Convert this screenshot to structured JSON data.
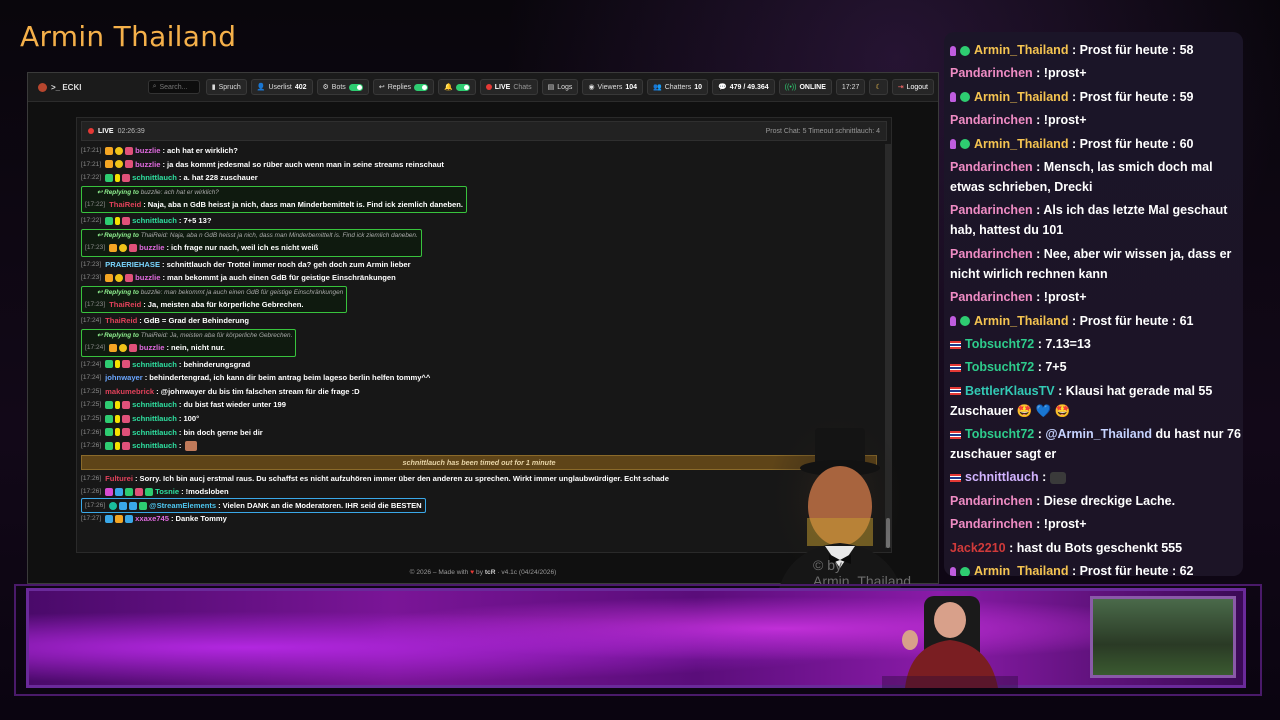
{
  "overlay": {
    "title": "Armin Thailand",
    "watermark": "© by Armin_Thailand"
  },
  "app": {
    "brand": ">_ ECKI",
    "search_placeholder": "Search...",
    "toolbar": {
      "spruch": "Spruch",
      "userlist": "Userlist",
      "userlist_count": "402",
      "bots": "Bots",
      "replies": "Replies",
      "live": "LIVE",
      "chats": "Chats",
      "logs": "Logs",
      "viewers": "Viewers",
      "viewers_count": "104",
      "chatters": "Chatters",
      "chatters_count": "10",
      "messages": "479 / 49.364",
      "status": "ONLINE",
      "time": "17:27",
      "logout": "Logout"
    },
    "chat_header": {
      "live": "LIVE",
      "uptime": "02:26:39",
      "right": "Prost Chat: 5   Timeout schnittlauch: 4"
    },
    "footer": {
      "left": "© 2026 – Made with",
      "by": "by",
      "author": "tcR",
      "version": "· v4.1c (04/24/2026)"
    }
  },
  "messages": [
    {
      "ts": "[17:21]",
      "badges": [
        "crown",
        "mod",
        "sub"
      ],
      "user": "buzzlie",
      "color": "#e06adf",
      "text": "ach hat er wirklich?"
    },
    {
      "ts": "[17:21]",
      "badges": [
        "crown",
        "mod",
        "sub"
      ],
      "user": "buzzlie",
      "color": "#e06adf",
      "text": "ja das kommt jedesmal so rüber auch wenn man in seine streams reinschaut"
    },
    {
      "ts": "[17:22]",
      "badges": [
        "vip",
        "bits",
        "sub"
      ],
      "user": "schnittlauch",
      "color": "#2ee0a0",
      "text": "a. hat 228 zuschauer"
    },
    {
      "reply": "buzzlie: ach hat er wirklich?",
      "ts": "[17:22]",
      "badges": [],
      "user": "ThaiReid",
      "color": "#e0415a",
      "text": "Naja, aba n GdB heisst ja nich, dass man Minderbemittelt is. Find ick ziemlich daneben."
    },
    {
      "ts": "[17:22]",
      "badges": [
        "vip",
        "bits",
        "sub"
      ],
      "user": "schnittlauch",
      "color": "#2ee0a0",
      "text": "7+5 13?"
    },
    {
      "reply": "ThaiReid: Naja, aba n GdB heisst ja nich, dass man Minderbemittelt is. Find ick ziemlich daneben.",
      "ts": "[17:23]",
      "badges": [
        "crown",
        "mod",
        "sub"
      ],
      "user": "buzzlie",
      "color": "#e06adf",
      "text": "ich frage nur nach, weil ich es nicht weiß"
    },
    {
      "ts": "[17:23]",
      "badges": [],
      "user": "PRAERIEHASE",
      "color": "#7ad7ff",
      "text": "schnittlauch der Trottel immer noch da? geh doch zum Armin lieber"
    },
    {
      "ts": "[17:23]",
      "badges": [
        "crown",
        "mod",
        "sub"
      ],
      "user": "buzzlie",
      "color": "#e06adf",
      "text": "man bekommt ja auch einen GdB für geistige Einschränkungen"
    },
    {
      "reply": "buzzlie: man bekommt ja auch einen GdB für geistige Einschränkungen",
      "ts": "[17:23]",
      "badges": [],
      "user": "ThaiReid",
      "color": "#e0415a",
      "text": "Ja, meisten aba für körperliche Gebrechen."
    },
    {
      "ts": "[17:24]",
      "badges": [],
      "user": "ThaiReid",
      "color": "#e0415a",
      "text": "GdB = Grad der Behinderung"
    },
    {
      "reply": "ThaiReid: Ja, meisten aba für körperliche Gebrechen.",
      "ts": "[17:24]",
      "badges": [
        "crown",
        "mod",
        "sub"
      ],
      "user": "buzzlie",
      "color": "#e06adf",
      "text": "nein, nicht nur."
    },
    {
      "ts": "[17:24]",
      "badges": [
        "vip",
        "bits",
        "sub"
      ],
      "user": "schnittlauch",
      "color": "#2ee0a0",
      "text": "behinderungsgrad"
    },
    {
      "ts": "[17:24]",
      "badges": [],
      "user": "johnwayer",
      "color": "#6aa6ff",
      "text": "behindertengrad, ich kann dir beim antrag beim lageso berlin helfen tommy^^"
    },
    {
      "ts": "[17:25]",
      "badges": [],
      "user": "makumebrick",
      "color": "#e0415a",
      "text": "@johnwayer du bis tim falschen stream für die frage :D"
    },
    {
      "ts": "[17:25]",
      "badges": [
        "vip",
        "bits",
        "sub"
      ],
      "user": "schnittlauch",
      "color": "#2ee0a0",
      "text": "du bist fast wieder unter 199"
    },
    {
      "ts": "[17:25]",
      "badges": [
        "vip",
        "bits",
        "sub"
      ],
      "user": "schnittlauch",
      "color": "#2ee0a0",
      "text": "100°"
    },
    {
      "ts": "[17:26]",
      "badges": [
        "vip",
        "bits",
        "sub"
      ],
      "user": "schnittlauch",
      "color": "#2ee0a0",
      "text": "bin doch gerne bei dir"
    },
    {
      "ts": "[17:26]",
      "badges": [
        "vip",
        "bits",
        "sub"
      ],
      "user": "schnittlauch",
      "color": "#2ee0a0",
      "text": ""
    },
    {
      "timeout": "schnittlauch has been timed out for 1 minute"
    },
    {
      "ts": "[17:26]",
      "badges": [],
      "user": "Fulturei",
      "color": "#e0415a",
      "text": "Sorry. Ich bin aucj erstmal raus. Du schaffst es nicht aufzuhören immer über den anderen zu sprechen. Wirkt immer unglaubwürdiger. Echt schade"
    },
    {
      "ts": "[17:26]",
      "badges": [
        "pink",
        "blue",
        "vip",
        "sub",
        "vip"
      ],
      "user": "Tosnie",
      "color": "#2ee0a0",
      "text": "!modsloben"
    },
    {
      "se": true,
      "ts": "[17:26]",
      "badges": [
        "teal",
        "blue",
        "blue",
        "vip"
      ],
      "user": "@StreamElements",
      "color": "#4ec7f0",
      "text": "Vielen DANK an die Moderatoren. IHR seid die BESTEN"
    },
    {
      "ts": "[17:27]",
      "badges": [
        "blue",
        "crown",
        "blue"
      ],
      "user": "xxaxe745",
      "color": "#e06adf",
      "text": "Danke Tommy"
    }
  ],
  "overlay_chat": [
    {
      "icons": [
        "mic",
        "check"
      ],
      "user": "Armin_Thailand",
      "cls": "nm-armin",
      "text": "Prost für heute : 58"
    },
    {
      "icons": [],
      "user": "Pandarinchen",
      "cls": "nm-pan",
      "text": "!prost+"
    },
    {
      "icons": [
        "mic",
        "check"
      ],
      "user": "Armin_Thailand",
      "cls": "nm-armin",
      "text": "Prost für heute : 59"
    },
    {
      "icons": [],
      "user": "Pandarinchen",
      "cls": "nm-pan",
      "text": "!prost+"
    },
    {
      "icons": [
        "mic",
        "check"
      ],
      "user": "Armin_Thailand",
      "cls": "nm-armin",
      "text": "Prost für heute : 60"
    },
    {
      "icons": [],
      "user": "Pandarinchen",
      "cls": "nm-pan",
      "text": "Mensch, las smich doch mal etwas schrieben, Drecki"
    },
    {
      "icons": [],
      "user": "Pandarinchen",
      "cls": "nm-pan",
      "text": "Als ich das letzte Mal geschaut hab, hattest du 101"
    },
    {
      "icons": [],
      "user": "Pandarinchen",
      "cls": "nm-pan",
      "text": "Nee, aber wir wissen ja, dass er nicht wirlich rechnen kann"
    },
    {
      "icons": [],
      "user": "Pandarinchen",
      "cls": "nm-pan",
      "text": "!prost+"
    },
    {
      "icons": [
        "mic",
        "check"
      ],
      "user": "Armin_Thailand",
      "cls": "nm-armin",
      "text": "Prost für heute : 61"
    },
    {
      "icons": [
        "flag"
      ],
      "user": "Tobsucht72",
      "cls": "nm-tob",
      "text": "7.13=13"
    },
    {
      "icons": [
        "flag"
      ],
      "user": "Tobsucht72",
      "cls": "nm-tob",
      "text": "7+5"
    },
    {
      "icons": [
        "flag"
      ],
      "user": "BettlerKlausTV",
      "cls": "nm-klaus",
      "text": "Klausi hat gerade mal 55 Zuschauer 🤩 💙 🤩"
    },
    {
      "icons": [
        "flag"
      ],
      "user": "Tobsucht72",
      "cls": "nm-tob",
      "text": "@Armin_Thailand du hast nur 76 zuschauer sagt er"
    },
    {
      "icons": [
        "flag"
      ],
      "user": "schnittlauch",
      "cls": "nm-sch",
      "text": ""
    },
    {
      "icons": [],
      "user": "Pandarinchen",
      "cls": "nm-pan",
      "text": "Diese dreckige Lache."
    },
    {
      "icons": [],
      "user": "Pandarinchen",
      "cls": "nm-pan",
      "text": "!prost+"
    },
    {
      "icons": [],
      "user": "Jack2210",
      "cls": "nm-jack",
      "text": "hast du Bots geschenkt 555"
    },
    {
      "icons": [
        "mic",
        "check"
      ],
      "user": "Armin_Thailand",
      "cls": "nm-armin",
      "text": "Prost für heute : 62"
    }
  ]
}
